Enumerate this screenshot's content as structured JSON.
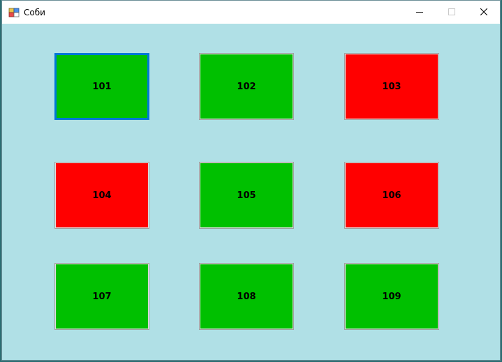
{
  "window": {
    "title": "Соби",
    "controls": {
      "minimize": "minimize-icon",
      "maximize": "maximize-icon",
      "close": "close-icon"
    }
  },
  "colors": {
    "background": "#b0e0e6",
    "available": "#00c000",
    "occupied": "#ff0000",
    "focus": "#0078d7"
  },
  "rooms": [
    {
      "label": "101",
      "status": "green",
      "focused": true
    },
    {
      "label": "102",
      "status": "green"
    },
    {
      "label": "103",
      "status": "red"
    },
    {
      "label": "104",
      "status": "red"
    },
    {
      "label": "105",
      "status": "green"
    },
    {
      "label": "106",
      "status": "red"
    },
    {
      "label": "107",
      "status": "green"
    },
    {
      "label": "108",
      "status": "green"
    },
    {
      "label": "109",
      "status": "green"
    }
  ]
}
